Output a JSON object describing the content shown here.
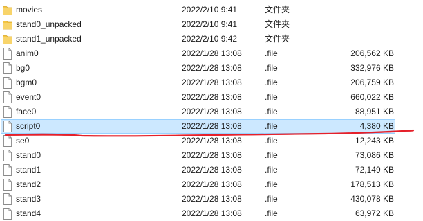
{
  "files": [
    {
      "name": "movies",
      "date": "2022/2/10 9:41",
      "type": "文件夹",
      "size": "",
      "kind": "folder-icon"
    },
    {
      "name": "stand0_unpacked",
      "date": "2022/2/10 9:41",
      "type": "文件夹",
      "size": "",
      "kind": "folder-icon"
    },
    {
      "name": "stand1_unpacked",
      "date": "2022/2/10 9:42",
      "type": "文件夹",
      "size": "",
      "kind": "folder-icon"
    },
    {
      "name": "anim0",
      "date": "2022/1/28 13:08",
      "type": ".file",
      "size": "206,562 KB",
      "kind": "file-icon"
    },
    {
      "name": "bg0",
      "date": "2022/1/28 13:08",
      "type": ".file",
      "size": "332,976 KB",
      "kind": "file-icon"
    },
    {
      "name": "bgm0",
      "date": "2022/1/28 13:08",
      "type": ".file",
      "size": "206,759 KB",
      "kind": "file-icon"
    },
    {
      "name": "event0",
      "date": "2022/1/28 13:08",
      "type": ".file",
      "size": "660,022 KB",
      "kind": "file-icon"
    },
    {
      "name": "face0",
      "date": "2022/1/28 13:08",
      "type": ".file",
      "size": "88,951 KB",
      "kind": "file-icon"
    },
    {
      "name": "script0",
      "date": "2022/1/28 13:08",
      "type": ".file",
      "size": "4,380 KB",
      "kind": "file-icon"
    },
    {
      "name": "se0",
      "date": "2022/1/28 13:08",
      "type": ".file",
      "size": "12,243 KB",
      "kind": "file-icon"
    },
    {
      "name": "stand0",
      "date": "2022/1/28 13:08",
      "type": ".file",
      "size": "73,086 KB",
      "kind": "file-icon"
    },
    {
      "name": "stand1",
      "date": "2022/1/28 13:08",
      "type": ".file",
      "size": "72,149 KB",
      "kind": "file-icon"
    },
    {
      "name": "stand2",
      "date": "2022/1/28 13:08",
      "type": ".file",
      "size": "178,513 KB",
      "kind": "file-icon"
    },
    {
      "name": "stand3",
      "date": "2022/1/28 13:08",
      "type": ".file",
      "size": "430,078 KB",
      "kind": "file-icon"
    },
    {
      "name": "stand4",
      "date": "2022/1/28 13:08",
      "type": ".file",
      "size": "63,972 KB",
      "kind": "file-icon"
    }
  ],
  "selected_file": "script0",
  "colors": {
    "folder": "#f4c542",
    "selection_bg": "#cce8ff",
    "selection_border": "#99d1ff",
    "annotation": "#e5202a"
  }
}
